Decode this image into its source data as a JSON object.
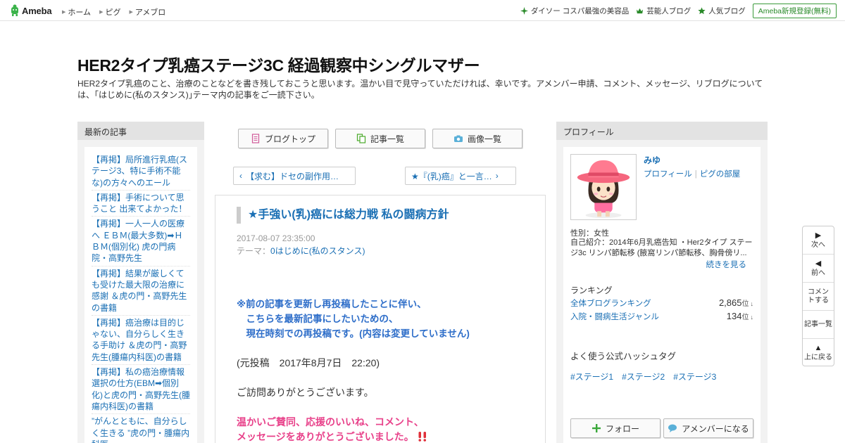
{
  "header": {
    "logo_text": "Ameba",
    "nav": [
      "ホーム",
      "ピグ",
      "アメブロ"
    ],
    "right_links": [
      {
        "label": "ダイソー コスパ最強の美容品",
        "icon": "sparkle-icon"
      },
      {
        "label": "芸能人ブログ",
        "icon": "crown-icon"
      },
      {
        "label": "人気ブログ",
        "icon": "star-icon"
      }
    ],
    "signup_label": "Ameba新規登録(無料)"
  },
  "blog": {
    "title": "HER2タイプ乳癌ステージ3C 経過観察中シングルマザー",
    "description": "HER2タイプ乳癌のこと、治療のことなどを書き残しておこうと思います。温かい目で見守っていただければ、幸いです。アメンバー申請、コメント、メッセージ、リブログについては、｢はじめに(私のスタンス)｣テーマ内の記事をご一読下さい。"
  },
  "left_sidebar": {
    "heading": "最新の記事",
    "items": [
      "【再掲】局所進行乳癌(ステージ3、特に手術不能な)の方々へのエール",
      "【再掲】手術について思うこと 出来てよかった！",
      "【再掲】一人一人の医療へ ＥＢＭ(最大多数)➡ＨＢＭ(個別化) 虎の門病院・高野先生",
      "【再掲】結果が厳しくても受けた最大限の治療に感謝 ＆虎の門・高野先生の書籍",
      "【再掲】癌治療は目的じゃない、自分らしく生きる手助け ＆虎の門・高野先生(腫瘍内科医)の書籍",
      "【再掲】私の癌治療情報選択の仕方(EBM➡個別化)と虎の門・高野先生(腫瘍内科医)の書籍",
      "”がんとともに、自分らしく生きる ”虎の門・腫瘍内科医"
    ]
  },
  "tabs": {
    "blog_top": "ブログトップ",
    "article_list": "記事一覧",
    "image_list": "画像一覧"
  },
  "pager": {
    "prev": "【求む】ドセの副作用…",
    "next": "★『(乳)癌』と一言…"
  },
  "article": {
    "title": "★手強い(乳)癌には総力戦 私の闘病方針",
    "date": "2017-08-07 23:35:00",
    "theme_label": "テーマ：",
    "theme": "0はじめに(私のスタンス)",
    "note_lines": [
      "※前の記事を更新し再投稿したことに伴い、",
      "　こちらを最新記事にしたいための、",
      "　現在時刻での再投稿です。(内容は変更していません)"
    ],
    "original_post": "(元投稿　2017年8月7日　22:20)",
    "greeting": "ご訪問ありがとうございます。",
    "thanks_lines": [
      "温かいご賛同、応援のいいね、コメント、",
      "メッセージをありがとうございました。"
    ]
  },
  "right_sidebar": {
    "heading": "プロフィール",
    "name": "みゆ",
    "link_profile": "プロフィール",
    "link_room": "ピグの部屋",
    "gender": "性別：女性",
    "intro": "自己紹介：2014年6月乳癌告知 ・Her2タイプ ステージ3c リンパ節転移 (腋窩リンパ節転移、胸骨傍リ...",
    "more": "続きを見る",
    "ranking_heading": "ランキング",
    "rankings": [
      {
        "name": "全体ブログランキング",
        "value": "2,865",
        "unit": "位",
        "trend": "↓"
      },
      {
        "name": "入院・闘病生活ジャンル",
        "value": "134",
        "unit": "位",
        "trend": "↓"
      }
    ],
    "hashtag_heading": "よく使う公式ハッシュタグ",
    "hashtags": [
      "#ステージ1",
      "#ステージ2",
      "#ステージ3"
    ],
    "follow_label": "フォロー",
    "amember_label": "アメンバーになる"
  },
  "float_nav": {
    "next": "次へ",
    "prev": "前へ",
    "comment": "コメントする",
    "list": "記事一覧",
    "top": "上に戻る"
  },
  "colors": {
    "link": "#1a6fb4",
    "accent_green": "#2a8a2a",
    "note_blue": "#2e6ec9",
    "pink": "#e8418a"
  }
}
